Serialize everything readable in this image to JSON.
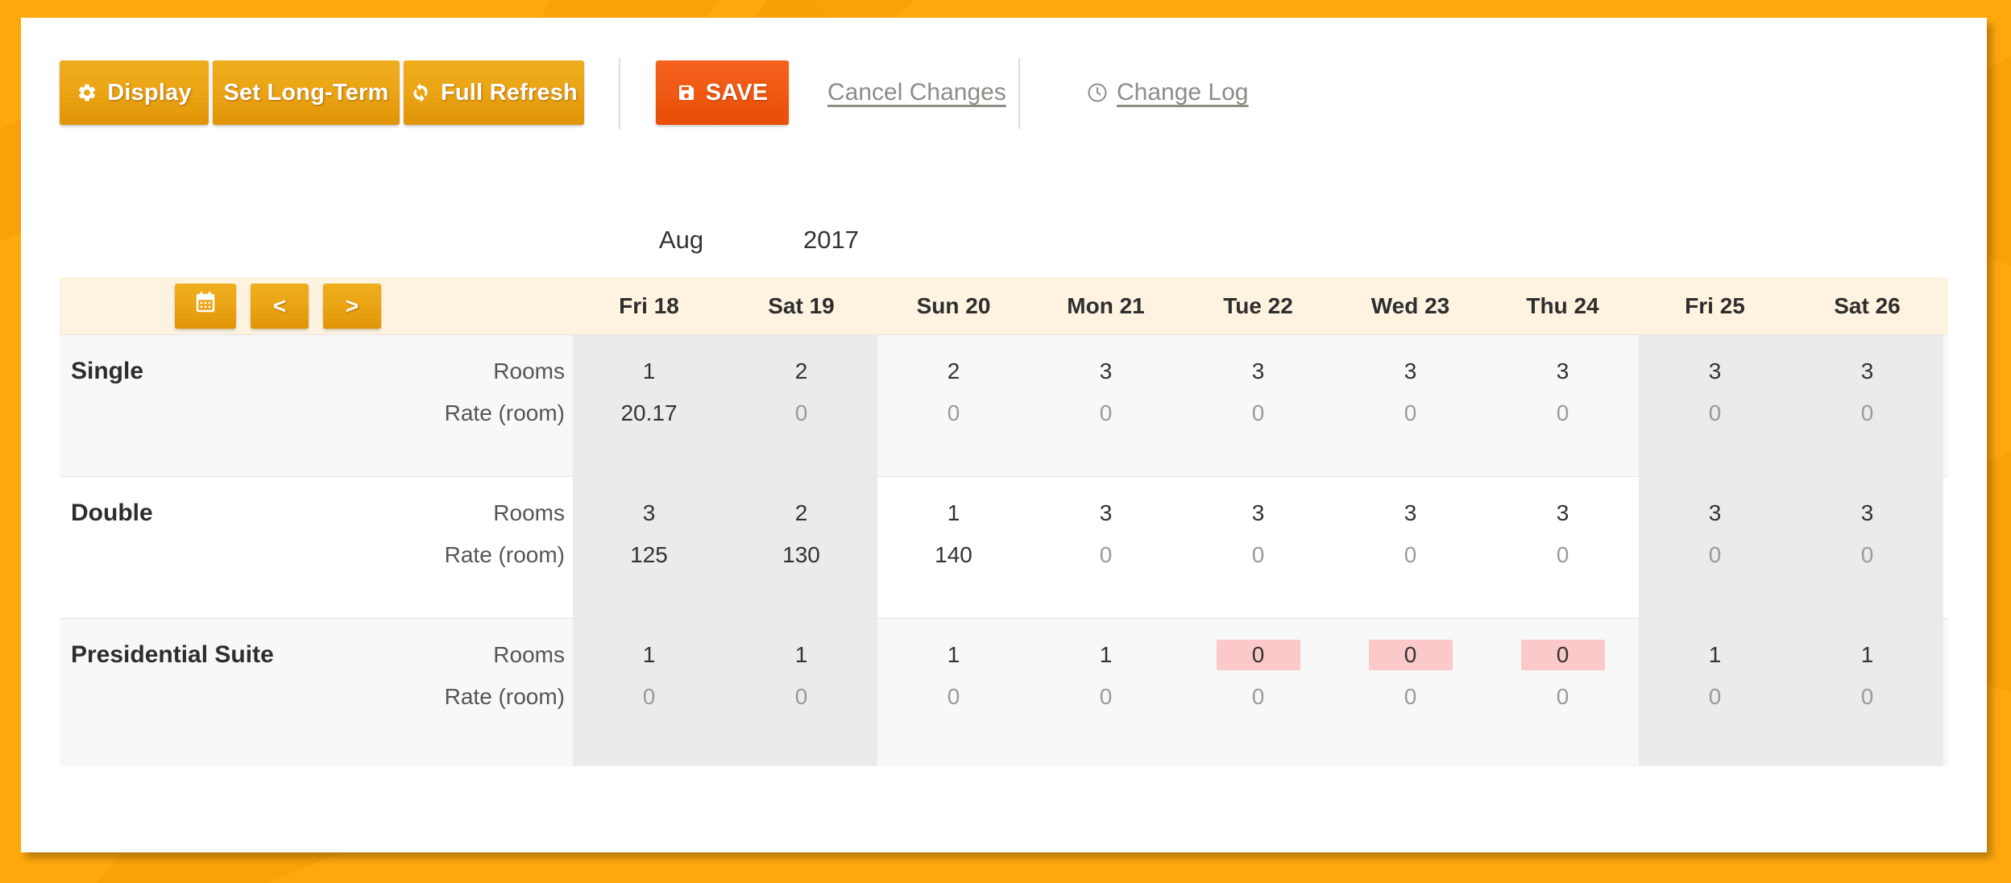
{
  "theme": {
    "page_bg": "#FFA80D",
    "card_bg": "#FFFFFF",
    "primary_orange": "#EBA515",
    "save_orange": "#EF5A14",
    "header_strip": "#FDF3E0",
    "weekend_shade": "#EBEBEB",
    "row_alt": "#F8F8F8",
    "flag_pink": "#FBC9C9",
    "link_grey": "#8D8D86"
  },
  "toolbar": {
    "display_label": "Display",
    "display_icon": "gear-icon",
    "long_term_label": "Set Long-Term",
    "full_refresh_label": "Full Refresh",
    "full_refresh_icon": "refresh-icon",
    "save_label": "SAVE",
    "save_icon": "floppy-disk-icon",
    "cancel_label": "Cancel Changes",
    "change_log_label": "Change Log",
    "change_log_icon": "clock-icon"
  },
  "calendar": {
    "month": "Aug",
    "year": "2017",
    "calendar_icon": "calendar-icon",
    "prev_label": "<",
    "next_label": ">"
  },
  "grid": {
    "metric_labels": [
      "Rooms",
      "Rate (room)"
    ],
    "days": [
      {
        "label": "Fri 18",
        "weekend": true
      },
      {
        "label": "Sat 19",
        "weekend": true
      },
      {
        "label": "Sun 20",
        "weekend": false
      },
      {
        "label": "Mon 21",
        "weekend": false
      },
      {
        "label": "Tue 22",
        "weekend": false
      },
      {
        "label": "Wed 23",
        "weekend": false
      },
      {
        "label": "Thu 24",
        "weekend": false
      },
      {
        "label": "Fri 25",
        "weekend": true
      },
      {
        "label": "Sat 26",
        "weekend": true
      }
    ],
    "rows": [
      {
        "room_type": "Single",
        "rooms": [
          "1",
          "2",
          "2",
          "3",
          "3",
          "3",
          "3",
          "3",
          "3"
        ],
        "rates": [
          "20.17",
          "0",
          "0",
          "0",
          "0",
          "0",
          "0",
          "0",
          "0"
        ],
        "rooms_flagged": [
          false,
          false,
          false,
          false,
          false,
          false,
          false,
          false,
          false
        ],
        "rates_zero": [
          false,
          true,
          true,
          true,
          true,
          true,
          true,
          true,
          true
        ]
      },
      {
        "room_type": "Double",
        "rooms": [
          "3",
          "2",
          "1",
          "3",
          "3",
          "3",
          "3",
          "3",
          "3"
        ],
        "rates": [
          "125",
          "130",
          "140",
          "0",
          "0",
          "0",
          "0",
          "0",
          "0"
        ],
        "rooms_flagged": [
          false,
          false,
          false,
          false,
          false,
          false,
          false,
          false,
          false
        ],
        "rates_zero": [
          false,
          false,
          false,
          true,
          true,
          true,
          true,
          true,
          true
        ]
      },
      {
        "room_type": "Presidential Suite",
        "rooms": [
          "1",
          "1",
          "1",
          "1",
          "0",
          "0",
          "0",
          "1",
          "1"
        ],
        "rates": [
          "0",
          "0",
          "0",
          "0",
          "0",
          "0",
          "0",
          "0",
          "0"
        ],
        "rooms_flagged": [
          false,
          false,
          false,
          false,
          true,
          true,
          true,
          false,
          false
        ],
        "rates_zero": [
          true,
          true,
          true,
          true,
          true,
          true,
          true,
          true,
          true
        ]
      }
    ]
  }
}
